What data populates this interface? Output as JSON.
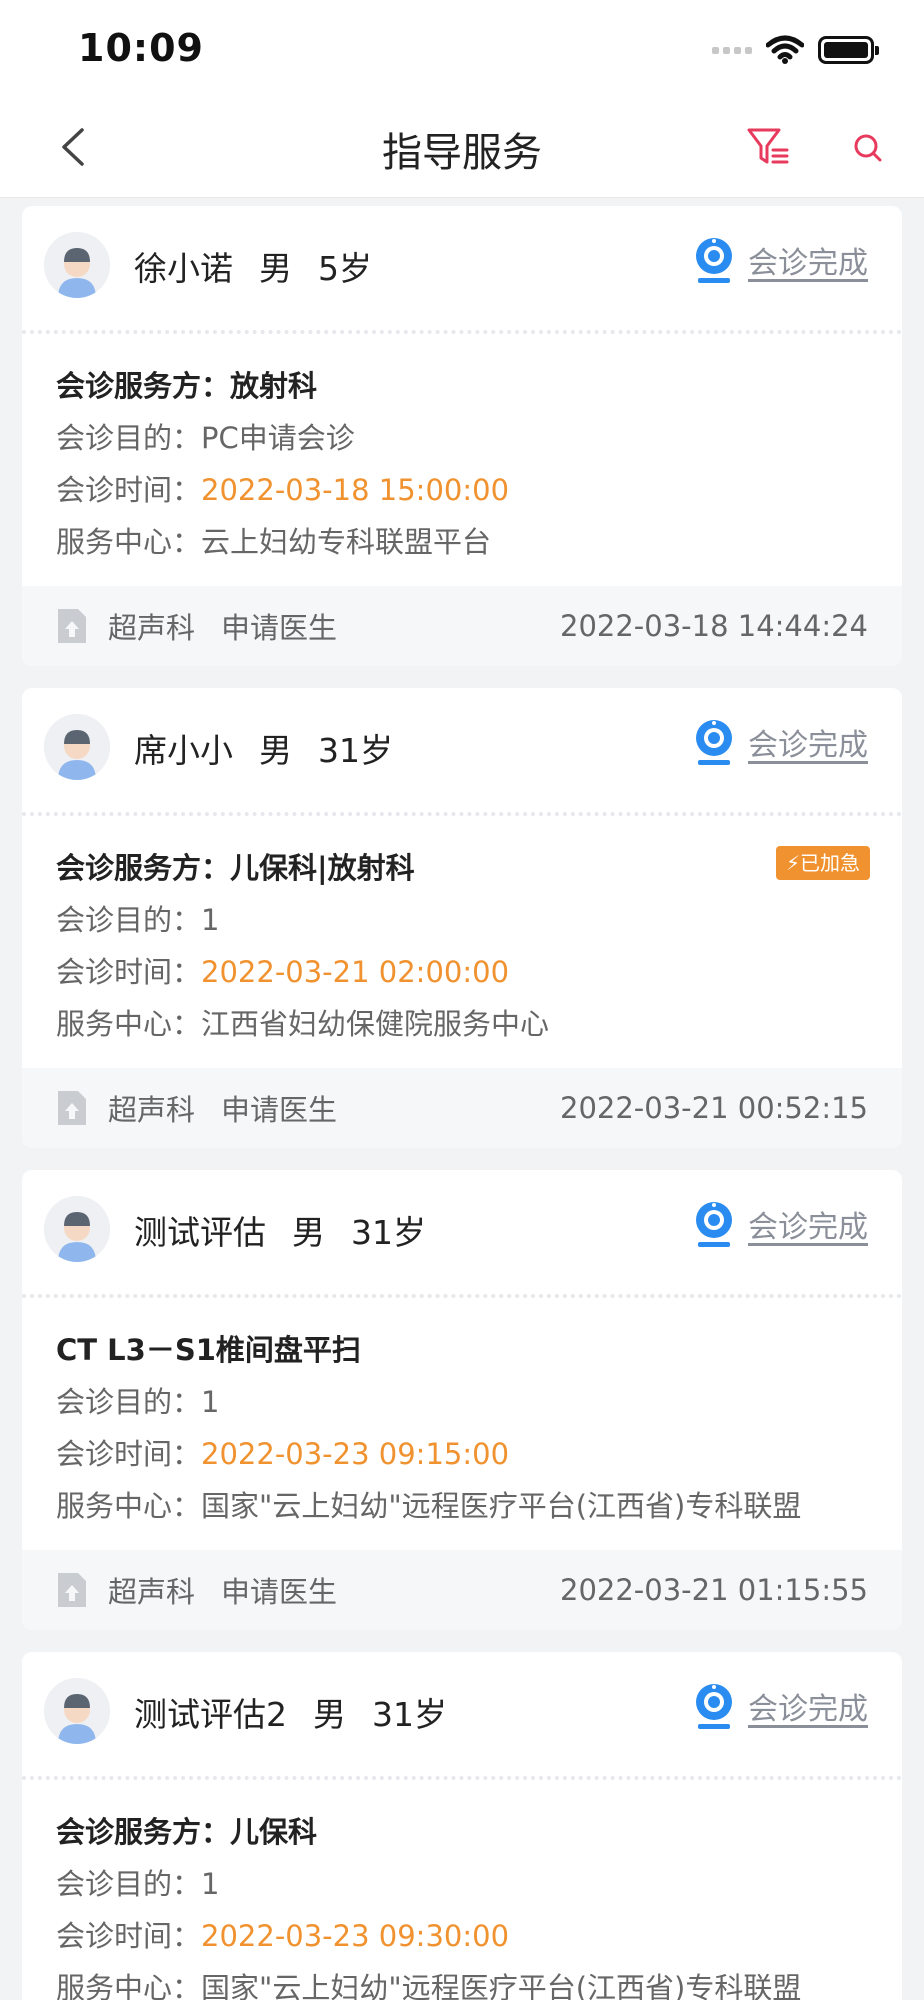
{
  "status_bar": {
    "time": "10:09"
  },
  "nav": {
    "title": "指导服务"
  },
  "colors": {
    "accent_orange": "#f0922f",
    "brand_blue": "#2a8cf0",
    "filter_pink": "#e83a5d"
  },
  "cards": [
    {
      "name": "徐小诺",
      "gender": "男",
      "age": "5岁",
      "status": "会诊完成",
      "line1": "会诊服务方：放射科",
      "purpose_label": "会诊目的：",
      "purpose": "PC申请会诊",
      "time_label": "会诊时间：",
      "time": "2022-03-18 15:00:00",
      "center_label": "服务中心：",
      "center": "云上妇幼专科联盟平台",
      "dept": "超声科",
      "role": "申请医生",
      "created": "2022-03-18 14:44:24"
    },
    {
      "name": "席小小",
      "gender": "男",
      "age": "31岁",
      "status": "会诊完成",
      "line1": "会诊服务方：儿保科|放射科",
      "urgent": "⚡已加急",
      "purpose_label": "会诊目的：",
      "purpose": "1",
      "time_label": "会诊时间：",
      "time": "2022-03-21 02:00:00",
      "center_label": "服务中心：",
      "center": "江西省妇幼保健院服务中心",
      "dept": "超声科",
      "role": "申请医生",
      "created": "2022-03-21 00:52:15"
    },
    {
      "name": "测试评估",
      "gender": "男",
      "age": "31岁",
      "status": "会诊完成",
      "line1": "CT  L3－S1椎间盘平扫",
      "purpose_label": "会诊目的：",
      "purpose": "1",
      "time_label": "会诊时间：",
      "time": "2022-03-23 09:15:00",
      "center_label": "服务中心：",
      "center": "国家\"云上妇幼\"远程医疗平台(江西省)专科联盟",
      "dept": "超声科",
      "role": "申请医生",
      "created": "2022-03-21 01:15:55"
    },
    {
      "name": "测试评估2",
      "gender": "男",
      "age": "31岁",
      "status": "会诊完成",
      "line1": "会诊服务方：儿保科",
      "purpose_label": "会诊目的：",
      "purpose": "1",
      "time_label": "会诊时间：",
      "time": "2022-03-23 09:30:00",
      "center_label": "服务中心：",
      "center": "国家\"云上妇幼\"远程医疗平台(江西省)专科联盟"
    }
  ]
}
